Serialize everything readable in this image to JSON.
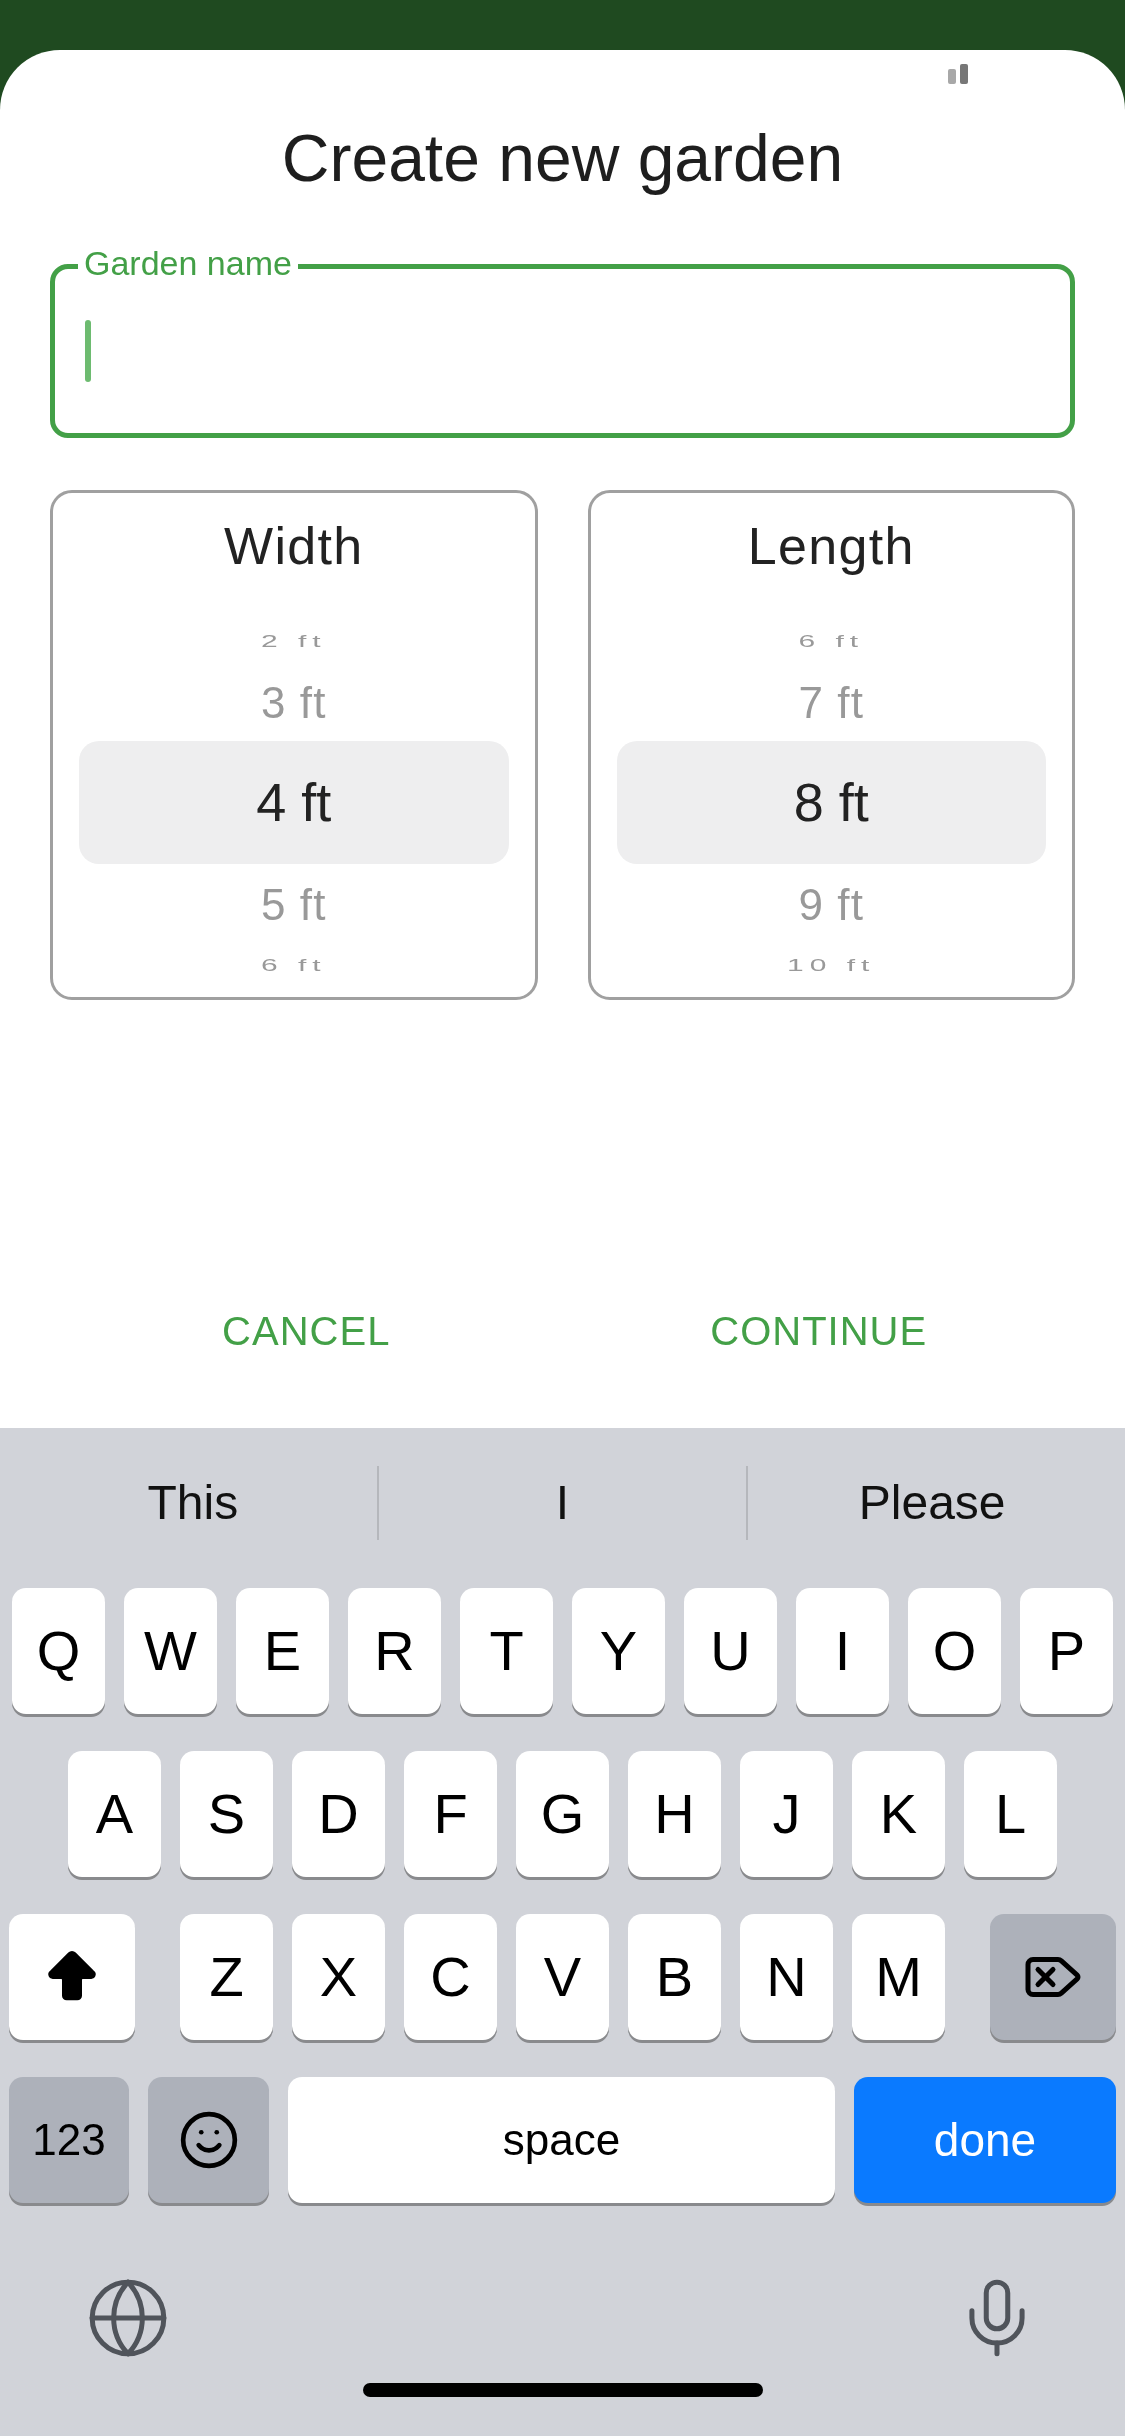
{
  "title": "Create new garden",
  "name_field": {
    "label": "Garden name",
    "focused": true
  },
  "pickers": [
    {
      "label": "Width",
      "options": [
        {
          "text": "2 ft",
          "selected": false
        },
        {
          "text": "3 ft",
          "selected": false
        },
        {
          "text": "4 ft",
          "selected": true
        },
        {
          "text": "5 ft",
          "selected": false
        },
        {
          "text": "6 ft",
          "selected": false
        }
      ]
    },
    {
      "label": "Length",
      "options": [
        {
          "text": "6 ft",
          "selected": false
        },
        {
          "text": "7 ft",
          "selected": false
        },
        {
          "text": "8 ft",
          "selected": true
        },
        {
          "text": "9 ft",
          "selected": false
        },
        {
          "text": "10 ft",
          "selected": false
        }
      ]
    }
  ],
  "actions": [
    {
      "label": "CANCEL"
    },
    {
      "label": "CONTINUE"
    }
  ],
  "keyboard": {
    "suggestions": [
      "This",
      "I",
      "Please"
    ],
    "rows": [
      {
        "keys": [
          {
            "kind": "letter",
            "label": "Q"
          },
          {
            "kind": "letter",
            "label": "W"
          },
          {
            "kind": "letter",
            "label": "E"
          },
          {
            "kind": "letter",
            "label": "R"
          },
          {
            "kind": "letter",
            "label": "T"
          },
          {
            "kind": "letter",
            "label": "Y"
          },
          {
            "kind": "letter",
            "label": "U"
          },
          {
            "kind": "letter",
            "label": "I"
          },
          {
            "kind": "letter",
            "label": "O"
          },
          {
            "kind": "letter",
            "label": "P"
          }
        ]
      },
      {
        "keys": [
          {
            "kind": "letter",
            "label": "A"
          },
          {
            "kind": "letter",
            "label": "S"
          },
          {
            "kind": "letter",
            "label": "D"
          },
          {
            "kind": "letter",
            "label": "F"
          },
          {
            "kind": "letter",
            "label": "G"
          },
          {
            "kind": "letter",
            "label": "H"
          },
          {
            "kind": "letter",
            "label": "J"
          },
          {
            "kind": "letter",
            "label": "K"
          },
          {
            "kind": "letter",
            "label": "L"
          }
        ]
      },
      {
        "keys": [
          {
            "kind": "shift"
          },
          {
            "kind": "letter",
            "label": "Z"
          },
          {
            "kind": "letter",
            "label": "X"
          },
          {
            "kind": "letter",
            "label": "C"
          },
          {
            "kind": "letter",
            "label": "V"
          },
          {
            "kind": "letter",
            "label": "B"
          },
          {
            "kind": "letter",
            "label": "N"
          },
          {
            "kind": "letter",
            "label": "M"
          },
          {
            "kind": "backspace"
          }
        ]
      },
      {
        "keys": [
          {
            "kind": "numbers",
            "label": "123"
          },
          {
            "kind": "emoji"
          },
          {
            "kind": "space",
            "label": "space"
          },
          {
            "kind": "done",
            "label": "done"
          }
        ]
      }
    ],
    "bottom": [
      {
        "kind": "globe"
      },
      {
        "kind": "mic"
      }
    ]
  }
}
